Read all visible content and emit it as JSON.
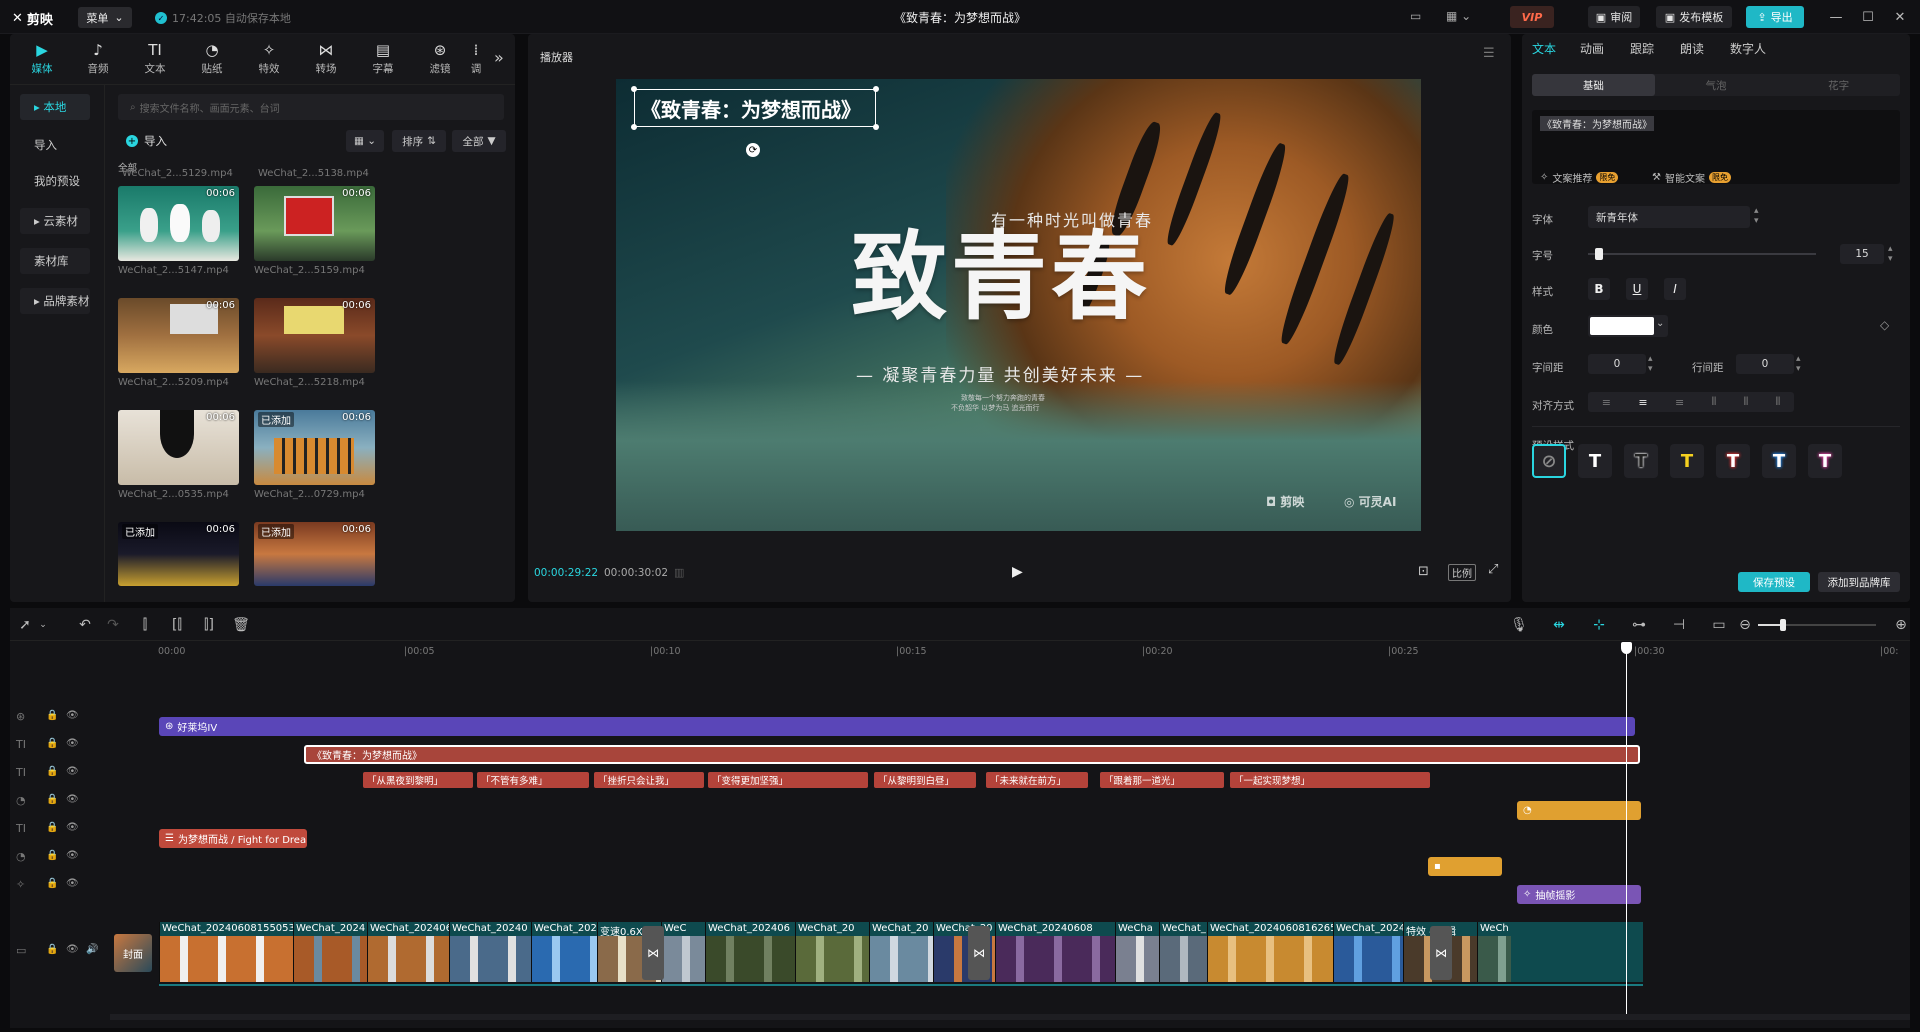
{
  "titlebar": {
    "app_name": "剪映",
    "menu": "菜单",
    "save_status": "17:42:05 自动保存本地",
    "project_title": "《致青春：为梦想而战》",
    "vip": "VIP",
    "review": "审阅",
    "publish_template": "发布模板",
    "export": "导出"
  },
  "media": {
    "tabs": [
      {
        "label": "媒体"
      },
      {
        "label": "音频"
      },
      {
        "label": "文本"
      },
      {
        "label": "贴纸"
      },
      {
        "label": "特效"
      },
      {
        "label": "转场"
      },
      {
        "label": "字幕"
      },
      {
        "label": "滤镜"
      },
      {
        "label": "调"
      }
    ],
    "side": [
      {
        "label": "▸ 本地"
      },
      {
        "label": "导入"
      },
      {
        "label": "我的预设"
      },
      {
        "label": "▸ 云素材"
      },
      {
        "label": "素材库"
      },
      {
        "label": "▸ 品牌素材"
      }
    ],
    "search_placeholder": "搜索文件名称、画面元素、台词",
    "import": "导入",
    "sort": "排序",
    "all": "全部",
    "section": "全部",
    "partial_names": [
      "WeChat_2...5129.mp4",
      "WeChat_2...5138.mp4"
    ],
    "items": [
      {
        "name": "WeChat_2...5147.mp4",
        "duration": "00:06",
        "added": ""
      },
      {
        "name": "WeChat_2...5159.mp4",
        "duration": "00:06",
        "added": ""
      },
      {
        "name": "WeChat_2...5209.mp4",
        "duration": "00:06",
        "added": ""
      },
      {
        "name": "WeChat_2...5218.mp4",
        "duration": "00:06",
        "added": ""
      },
      {
        "name": "WeChat_2...0535.mp4",
        "duration": "00:06",
        "added": ""
      },
      {
        "name": "WeChat_2...0729.mp4",
        "duration": "00:06",
        "added": "已添加"
      },
      {
        "name": "",
        "duration": "00:06",
        "added": "已添加"
      },
      {
        "name": "",
        "duration": "00:06",
        "added": "已添加"
      }
    ]
  },
  "player": {
    "label": "播放器",
    "selected_text": "《致青春：为梦想而战》",
    "subtitle_line": "有一种时光叫做青春",
    "big_title": "致青春",
    "slogan": "— 凝聚青春力量 共创美好未来 —",
    "small_lines": [
      "致敬每一个努力奔跑的青春",
      "不负韶华 以梦为马 追光而行"
    ],
    "watermark1": "剪映",
    "watermark2": "可灵AI",
    "current_time": "00:00:29:22",
    "total_time": "00:00:30:02",
    "ratio": "比例"
  },
  "props": {
    "tabs": [
      {
        "label": "文本"
      },
      {
        "label": "动画"
      },
      {
        "label": "跟踪"
      },
      {
        "label": "朗读"
      },
      {
        "label": "数字人"
      }
    ],
    "segments": [
      "基础",
      "气泡",
      "花字"
    ],
    "text_value": "《致青春：为梦想而战》",
    "recommend": "文案推荐",
    "smart_copy": "智能文案",
    "limited": "限免",
    "font_label": "字体",
    "font_value": "新青年体",
    "size_label": "字号",
    "size_value": "15",
    "size_fraction": 0.03,
    "style_label": "样式",
    "color_label": "颜色",
    "color_value": "#ffffff",
    "letter_spacing_label": "字间距",
    "letter_spacing": "0",
    "line_spacing_label": "行间距",
    "line_spacing": "0",
    "align_label": "对齐方式",
    "preset_label": "预设样式",
    "save_preset": "保存预设",
    "add_brand": "添加到品牌库"
  },
  "timeline": {
    "ruler": [
      "00:00",
      "|00:05",
      "|00:10",
      "|00:15",
      "|00:20",
      "|00:25",
      "|00:30",
      "|00:"
    ],
    "filter_clip": "好莱坞IV",
    "title_clip": "《致青春：为梦想而战》",
    "subtitles": [
      "「从黑夜到黎明」",
      "「不管有多难」",
      "「挫折只会让我」",
      "「变得更加坚强」",
      "「从黎明到白昼」",
      "「未来就在前方」",
      "「跟着那一道光」",
      "「一起实现梦想」"
    ],
    "music_text": "为梦想而战 / Fight for Drea",
    "effect_clip": "抽帧摇影",
    "cover": "封面",
    "video_clips": [
      "WeChat_20240608155053",
      "WeChat_2024",
      "WeChat_202406",
      "WeChat_20240",
      "WeChat_202",
      "变速0.6X",
      "WeC",
      "WeChat_202406",
      "WeChat_20",
      "WeChat_20",
      "WeChat_20",
      "WeChat_20240608",
      "WeCha",
      "WeChat_",
      "WeChat_20240608162655",
      "WeChat_20240",
      "特效 - 编辑",
      "WeCh"
    ]
  },
  "colors": {
    "accent": "#2ad6e0",
    "filter": "#5a46b8",
    "title_clip": "#a8453b",
    "subtitle": "#b4433a",
    "sticker": "#e0a030",
    "effect": "#7a55b5",
    "music": "#c04a3c"
  }
}
